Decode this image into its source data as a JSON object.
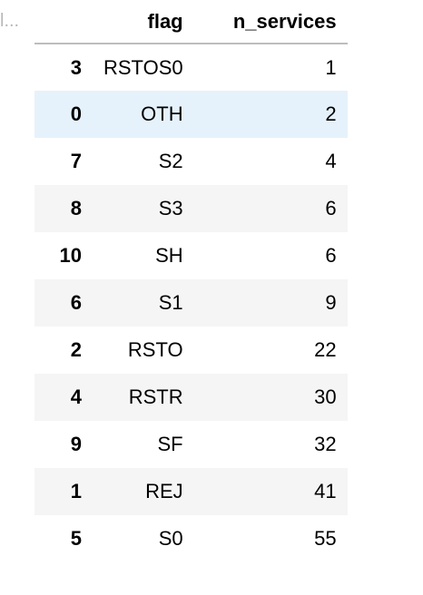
{
  "truncated_cell": "l...",
  "table": {
    "columns": {
      "index": "",
      "flag": "flag",
      "n_services": "n_services"
    },
    "rows": [
      {
        "index": "3",
        "flag": "RSTOS0",
        "n_services": "1"
      },
      {
        "index": "0",
        "flag": "OTH",
        "n_services": "2"
      },
      {
        "index": "7",
        "flag": "S2",
        "n_services": "4"
      },
      {
        "index": "8",
        "flag": "S3",
        "n_services": "6"
      },
      {
        "index": "10",
        "flag": "SH",
        "n_services": "6"
      },
      {
        "index": "6",
        "flag": "S1",
        "n_services": "9"
      },
      {
        "index": "2",
        "flag": "RSTO",
        "n_services": "22"
      },
      {
        "index": "4",
        "flag": "RSTR",
        "n_services": "30"
      },
      {
        "index": "9",
        "flag": "SF",
        "n_services": "32"
      },
      {
        "index": "1",
        "flag": "REJ",
        "n_services": "41"
      },
      {
        "index": "5",
        "flag": "S0",
        "n_services": "55"
      }
    ],
    "hovered_row": 1
  },
  "colors": {
    "hover_row": "#e6f2fb",
    "striped_row": "#f5f5f5",
    "header_rule": "#bdbdbd"
  }
}
